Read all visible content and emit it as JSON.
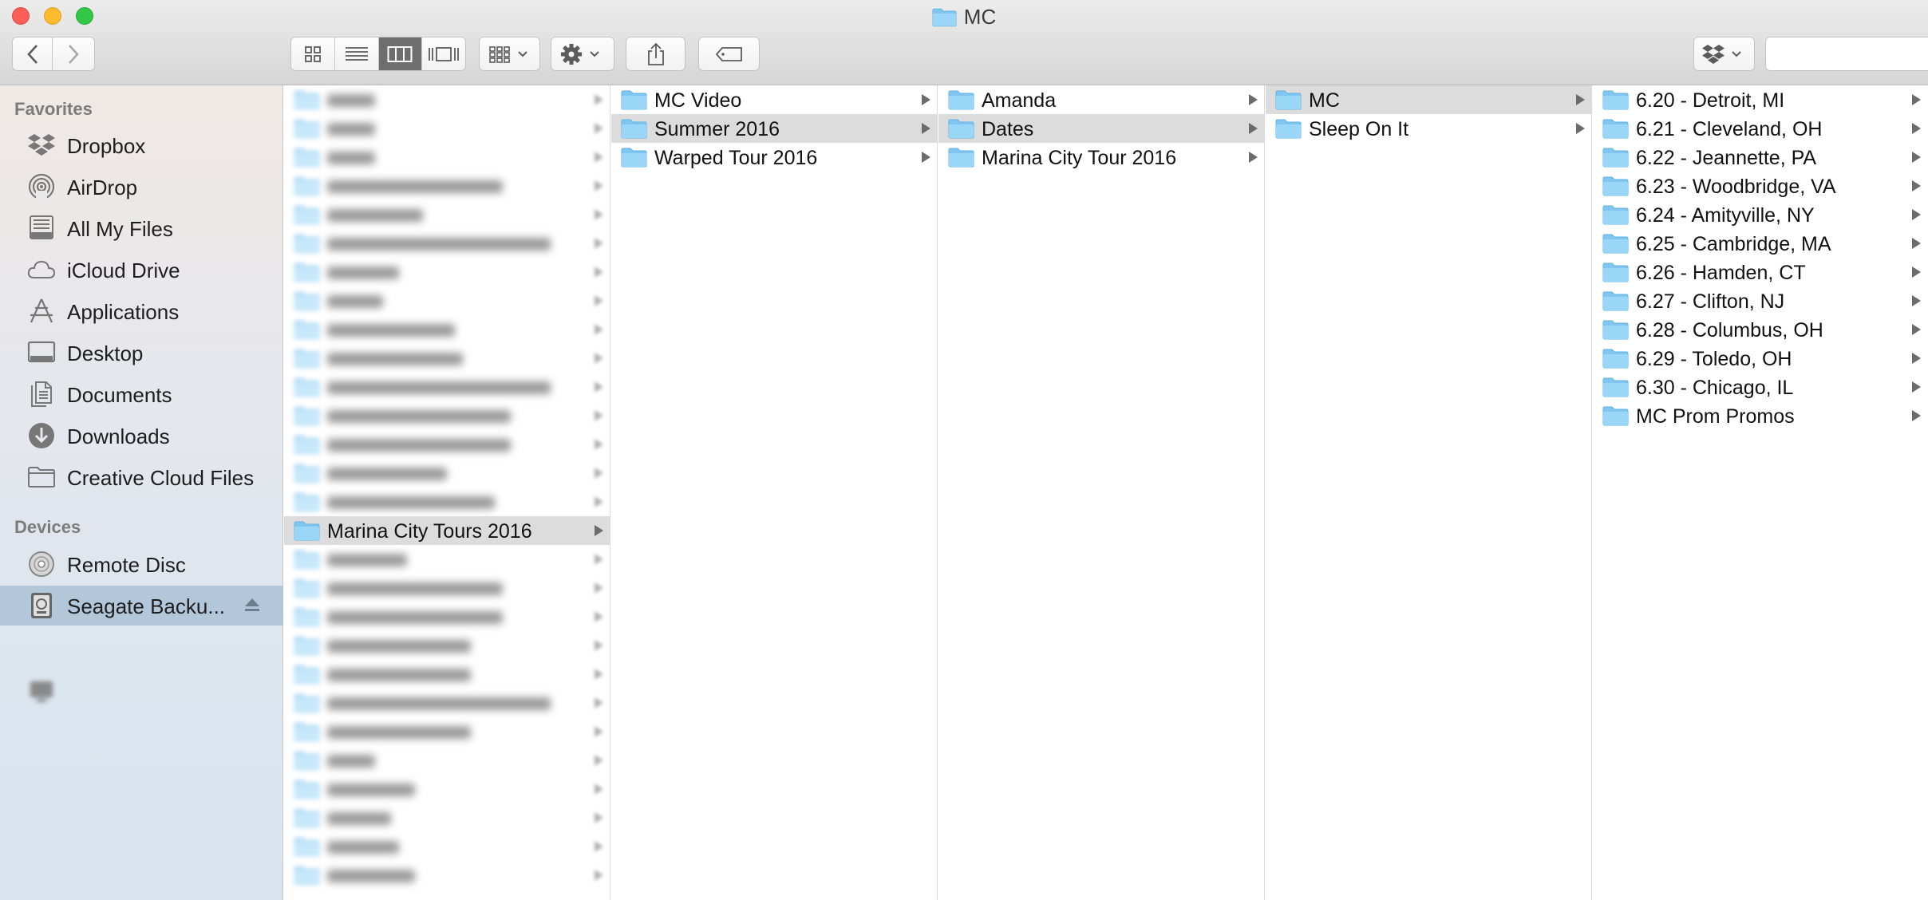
{
  "window": {
    "title": "MC"
  },
  "toolbar": {
    "back_icon": "chevron-left-icon",
    "forward_icon": "chevron-right-icon",
    "view_modes": [
      "icon-view-icon",
      "list-view-icon",
      "column-view-icon",
      "cover-flow-icon"
    ],
    "active_view": "column-view-icon",
    "arrange_icon": "group-icon",
    "action_icon": "gear-icon",
    "share_icon": "share-icon",
    "tags_icon": "tag-icon",
    "dropbox_icon": "dropbox-icon",
    "search_placeholder": ""
  },
  "sidebar": {
    "favorites_label": "Favorites",
    "favorites": [
      {
        "label": "Dropbox",
        "icon": "dropbox-icon"
      },
      {
        "label": "AirDrop",
        "icon": "airdrop-icon"
      },
      {
        "label": "All My Files",
        "icon": "all-files-icon"
      },
      {
        "label": "iCloud Drive",
        "icon": "cloud-icon"
      },
      {
        "label": "Applications",
        "icon": "applications-icon"
      },
      {
        "label": "Desktop",
        "icon": "desktop-icon"
      },
      {
        "label": "Documents",
        "icon": "documents-icon"
      },
      {
        "label": "Downloads",
        "icon": "downloads-icon"
      },
      {
        "label": "Creative Cloud Files",
        "icon": "folder-icon"
      }
    ],
    "devices_label": "Devices",
    "devices": [
      {
        "label": "Remote Disc",
        "icon": "disc-icon"
      },
      {
        "label": "Seagate Backu...",
        "icon": "drive-icon",
        "selected": true
      }
    ]
  },
  "columns": {
    "col1": {
      "selected": "Marina City Tours 2016"
    },
    "col2": {
      "items": [
        "MC Video",
        "Summer 2016",
        "Warped Tour 2016"
      ],
      "selected": 1
    },
    "col3": {
      "items": [
        "Amanda",
        "Dates",
        "Marina City Tour 2016"
      ],
      "selected": 1
    },
    "col4": {
      "items": [
        "MC",
        "Sleep On It"
      ],
      "selected": 0
    },
    "col5": {
      "items": [
        "6.20 - Detroit, MI",
        "6.21 - Cleveland, OH",
        "6.22 - Jeannette, PA",
        "6.23 - Woodbridge, VA",
        "6.24 - Amityville, NY",
        "6.25 - Cambridge, MA",
        "6.26 - Hamden, CT",
        "6.27 - Clifton, NJ",
        "6.28 - Columbus, OH",
        "6.29 - Toledo, OH",
        "6.30 - Chicago, IL",
        "MC Prom Promos"
      ]
    }
  },
  "colors": {
    "folder": "#8fd0f5",
    "selection": "#dcdcdc",
    "sidebar_selection": "#b3c7da"
  }
}
